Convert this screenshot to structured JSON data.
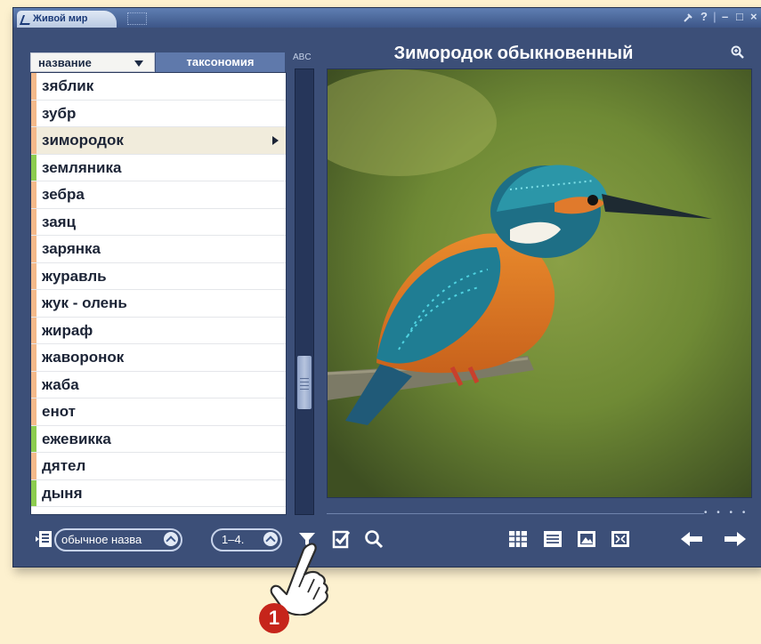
{
  "app": {
    "title": "Живой мир",
    "window_controls": [
      "?",
      "–",
      "□",
      "×"
    ]
  },
  "list": {
    "header_name": "название",
    "header_taxonomy": "таксономия",
    "abc_label": "ABC",
    "items": [
      {
        "label": "зяблик",
        "color": "#f3b98a"
      },
      {
        "label": "зубр",
        "color": "#f3b98a"
      },
      {
        "label": "зимородок",
        "color": "#f3b98a",
        "selected": true
      },
      {
        "label": "земляника",
        "color": "#8ccc4f"
      },
      {
        "label": "зебра",
        "color": "#f3b98a"
      },
      {
        "label": "заяц",
        "color": "#f3b98a"
      },
      {
        "label": "зарянка",
        "color": "#f3b98a"
      },
      {
        "label": "журавль",
        "color": "#f3b98a"
      },
      {
        "label": "жук - олень",
        "color": "#f3b98a"
      },
      {
        "label": "жираф",
        "color": "#f3b98a"
      },
      {
        "label": "жаворонок",
        "color": "#f3b98a"
      },
      {
        "label": "жаба",
        "color": "#f3b98a"
      },
      {
        "label": "енот",
        "color": "#f3b98a"
      },
      {
        "label": "ежевикка",
        "color": "#8ccc4f"
      },
      {
        "label": "дятел",
        "color": "#f3b98a"
      },
      {
        "label": "дыня",
        "color": "#8ccc4f"
      }
    ]
  },
  "viewer": {
    "title": "Зимородок обыкновенный",
    "pager": "• • • •"
  },
  "toolbar": {
    "name_mode_label": "обычное назва",
    "range_label": "1–4."
  },
  "callout": {
    "number": "1"
  },
  "colors": {
    "window_bg": "#3c4f78",
    "page_bg": "#fdf1cf",
    "accent": "#5f79ab",
    "badge": "#c6251b"
  }
}
